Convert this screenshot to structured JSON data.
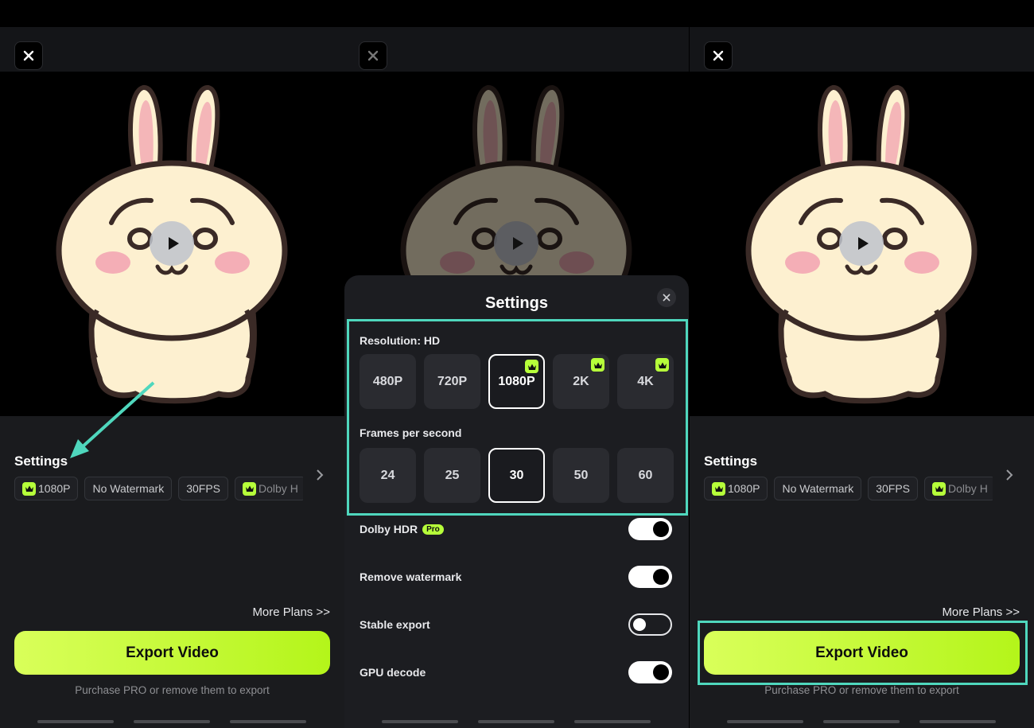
{
  "colors": {
    "accent_green": "#b6ff3a",
    "highlight_teal": "#4fd7bd",
    "panel_bg": "#1a1b1e"
  },
  "panels": [
    {
      "settings_title": "Settings",
      "chips": [
        {
          "label": "1080P",
          "icon": "crown-icon"
        },
        {
          "label": "No Watermark"
        },
        {
          "label": "30FPS"
        },
        {
          "label": "Dolby H",
          "icon": "crown-icon"
        }
      ],
      "more_plans": "More Plans >>",
      "export_label": "Export Video",
      "purchase_note": "Purchase PRO or remove them to export"
    },
    {
      "sheet": {
        "title": "Settings",
        "resolution_label": "Resolution: HD",
        "resolutions": [
          {
            "label": "480P"
          },
          {
            "label": "720P"
          },
          {
            "label": "1080P",
            "selected": true,
            "pro": true
          },
          {
            "label": "2K",
            "pro": true
          },
          {
            "label": "4K",
            "pro": true
          }
        ],
        "fps_label": "Frames per second",
        "fps": [
          {
            "label": "24"
          },
          {
            "label": "25"
          },
          {
            "label": "30",
            "selected": true
          },
          {
            "label": "50"
          },
          {
            "label": "60"
          }
        ],
        "toggles": [
          {
            "label": "Dolby HDR",
            "badge": "Pro",
            "on": true
          },
          {
            "label": "Remove watermark",
            "on": true
          },
          {
            "label": "Stable export",
            "on": false
          },
          {
            "label": "GPU decode",
            "on": true
          }
        ]
      }
    },
    {
      "settings_title": "Settings",
      "chips": [
        {
          "label": "1080P",
          "icon": "crown-icon"
        },
        {
          "label": "No Watermark"
        },
        {
          "label": "30FPS"
        },
        {
          "label": "Dolby H",
          "icon": "crown-icon"
        }
      ],
      "more_plans": "More Plans >>",
      "export_label": "Export Video",
      "purchase_note": "Purchase PRO or remove them to export"
    }
  ]
}
